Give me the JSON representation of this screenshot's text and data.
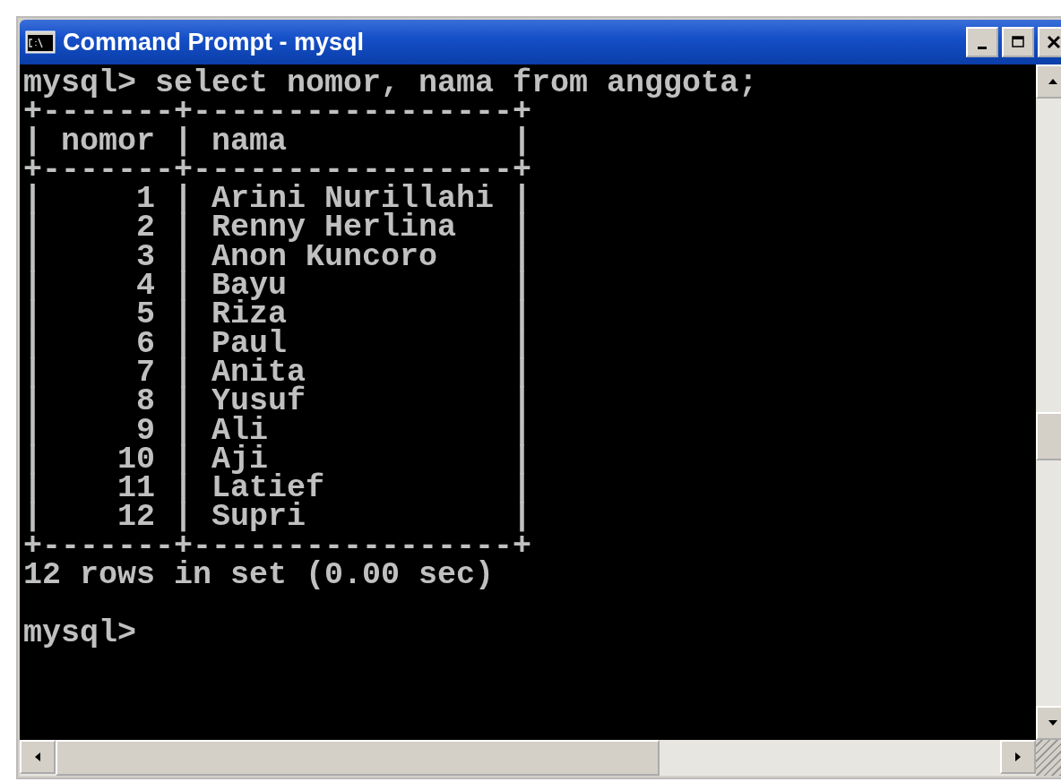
{
  "window": {
    "title": "Command Prompt - mysql"
  },
  "console": {
    "lines": [
      "mysql> select nomor, nama from anggota;",
      "+-------+-----------------+",
      "| nomor | nama            |",
      "+-------+-----------------+",
      "|     1 | Arini Nurillahi |",
      "|     2 | Renny Herlina   |",
      "|     3 | Anon Kuncoro    |",
      "|     4 | Bayu            |",
      "|     5 | Riza            |",
      "|     6 | Paul            |",
      "|     7 | Anita           |",
      "|     8 | Yusuf           |",
      "|     9 | Ali             |",
      "|    10 | Aji             |",
      "|    11 | Latief          |",
      "|    12 | Supri           |",
      "+-------+-----------------+",
      "12 rows in set (0.00 sec)"
    ],
    "prompt": "mysql>"
  }
}
